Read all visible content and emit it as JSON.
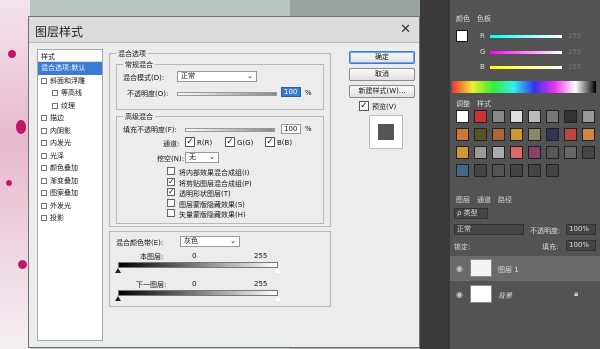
{
  "dialog": {
    "title": "图层样式",
    "close": "✕",
    "styles_header": "样式",
    "styles": [
      {
        "label": "混合选项:默认",
        "selected": true,
        "checkbox": false,
        "indent": false
      },
      {
        "label": "斜面和浮雕",
        "checkbox": true,
        "indent": false
      },
      {
        "label": "等高线",
        "checkbox": true,
        "indent": true
      },
      {
        "label": "纹理",
        "checkbox": true,
        "indent": true
      },
      {
        "label": "描边",
        "checkbox": true,
        "indent": false
      },
      {
        "label": "内阴影",
        "checkbox": true,
        "indent": false
      },
      {
        "label": "内发光",
        "checkbox": true,
        "indent": false
      },
      {
        "label": "光泽",
        "checkbox": true,
        "indent": false
      },
      {
        "label": "颜色叠加",
        "checkbox": true,
        "indent": false
      },
      {
        "label": "渐变叠加",
        "checkbox": true,
        "indent": false
      },
      {
        "label": "图案叠加",
        "checkbox": true,
        "indent": false
      },
      {
        "label": "外发光",
        "checkbox": true,
        "indent": false
      },
      {
        "label": "投影",
        "checkbox": true,
        "indent": false
      }
    ],
    "blend_options": "混合选项",
    "general_blending": "常规混合",
    "blend_mode_label": "混合模式(D):",
    "blend_mode_value": "正常",
    "opacity_label": "不透明度(O):",
    "opacity_value": "100",
    "percent": "%",
    "advanced_blending": "高级混合",
    "fill_opacity_label": "填充不透明度(F):",
    "fill_opacity_value": "100",
    "channels_label": "通道:",
    "channel_r": "R(R)",
    "channel_g": "G(G)",
    "channel_b": "B(B)",
    "knockout_label": "挖空(N):",
    "knockout_value": "无",
    "options": [
      {
        "label": "将内部效果混合成组(I)",
        "checked": false
      },
      {
        "label": "将剪贴图层混合成组(P)",
        "checked": true
      },
      {
        "label": "透明形状图层(T)",
        "checked": true
      },
      {
        "label": "图层蒙版隐藏效果(S)",
        "checked": false
      },
      {
        "label": "矢量蒙版隐藏效果(H)",
        "checked": false
      }
    ],
    "blend_if_label": "混合颜色带(E):",
    "blend_if_value": "灰色",
    "this_layer_label": "本图层:",
    "under_layer_label": "下一图层:",
    "range_min": "0",
    "range_max": "255",
    "ok": "确定",
    "cancel": "取消",
    "new_style": "新建样式(W)...",
    "preview": "预览(V)"
  },
  "panels": {
    "color_tabs": [
      "颜色",
      "色板"
    ],
    "r_label": "R",
    "g_label": "G",
    "b_label": "B",
    "r_value": "255",
    "g_value": "255",
    "b_value": "255",
    "adjust_tabs": [
      "调整",
      "样式"
    ],
    "layers_tabs": [
      "图层",
      "通道",
      "路径"
    ],
    "kind_label": "ρ 类型",
    "blend_mode": "正常",
    "opacity_label": "不透明度:",
    "opacity_value": "100%",
    "lock_label": "锁定:",
    "fill_label": "填充:",
    "fill_value": "100%",
    "layer1": "图层 1",
    "background": "背景"
  },
  "colors": {
    "accent": "#3b7bd4",
    "panel_bg": "#535353"
  }
}
